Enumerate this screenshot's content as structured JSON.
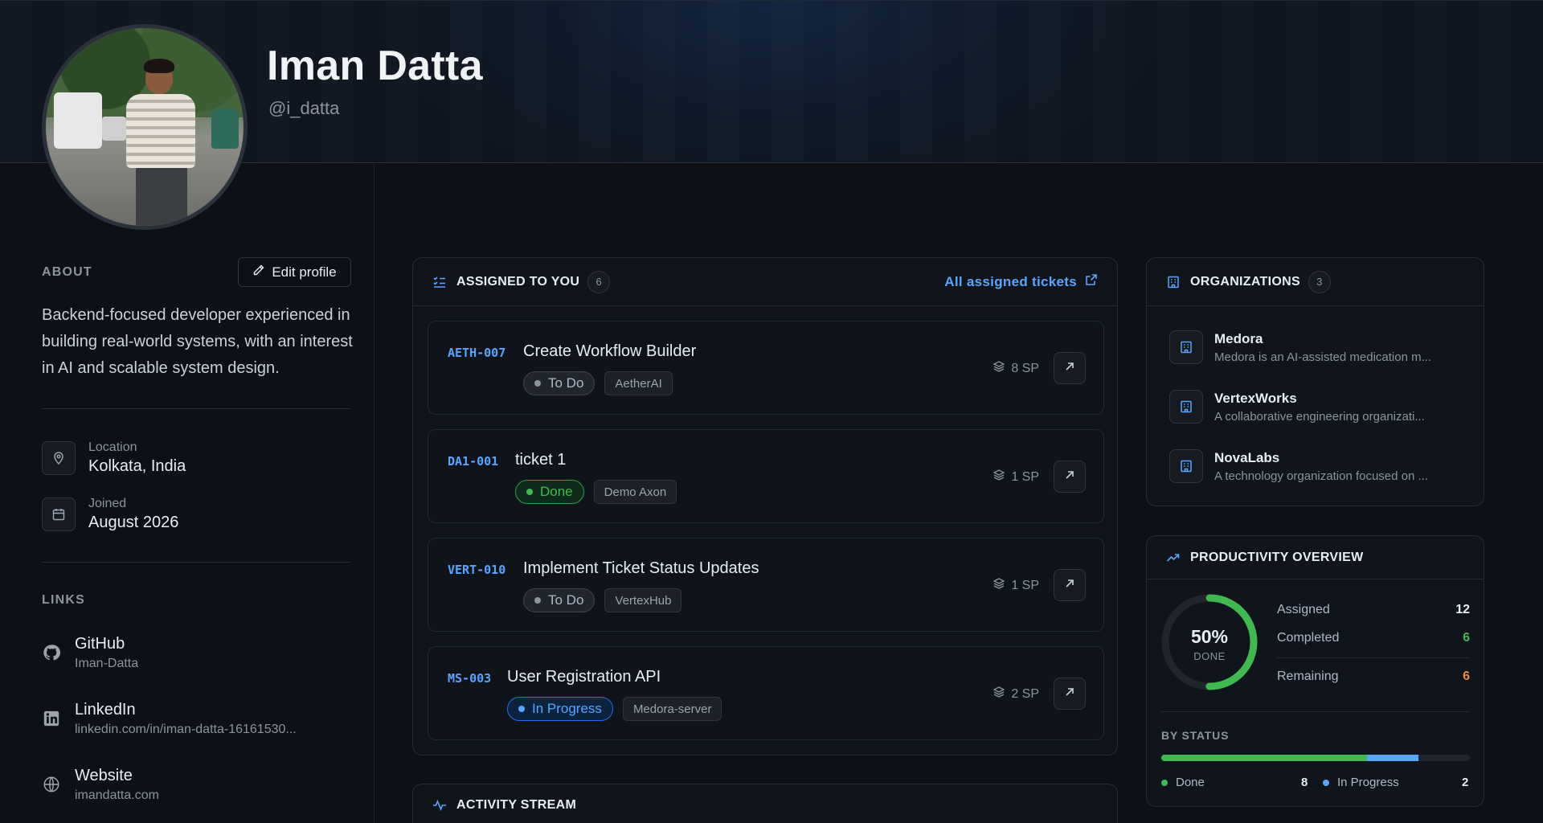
{
  "profile": {
    "name": "Iman Datta",
    "handle": "@i_datta"
  },
  "about": {
    "heading": "ABOUT",
    "edit_label": "Edit profile",
    "bio": "Backend-focused developer experienced in building real-world systems, with an interest in AI and scalable system design.",
    "location_label": "Location",
    "location_value": "Kolkata, India",
    "joined_label": "Joined",
    "joined_value": "August 2026"
  },
  "links": {
    "heading": "LINKS",
    "items": [
      {
        "title": "GitHub",
        "sub": "Iman-Datta",
        "icon": "github-icon"
      },
      {
        "title": "LinkedIn",
        "sub": "linkedin.com/in/iman-datta-16161530...",
        "icon": "linkedin-icon"
      },
      {
        "title": "Website",
        "sub": "imandatta.com",
        "icon": "globe-icon"
      }
    ]
  },
  "assigned": {
    "heading": "ASSIGNED TO YOU",
    "count": "6",
    "all_link": "All assigned tickets",
    "tickets": [
      {
        "key": "AETH-007",
        "title": "Create Workflow Builder",
        "status": "To Do",
        "project": "AetherAI",
        "sp": "8 SP"
      },
      {
        "key": "DA1-001",
        "title": "ticket 1",
        "status": "Done",
        "project": "Demo Axon",
        "sp": "1 SP"
      },
      {
        "key": "VERT-010",
        "title": "Implement Ticket Status Updates",
        "status": "To Do",
        "project": "VertexHub",
        "sp": "1 SP"
      },
      {
        "key": "MS-003",
        "title": "User Registration API",
        "status": "In Progress",
        "project": "Medora-server",
        "sp": "2 SP"
      }
    ]
  },
  "activity": {
    "heading": "ACTIVITY STREAM"
  },
  "organizations": {
    "heading": "ORGANIZATIONS",
    "count": "3",
    "items": [
      {
        "name": "Medora",
        "desc": "Medora is an AI-assisted medication m..."
      },
      {
        "name": "VertexWorks",
        "desc": "A collaborative engineering organizati..."
      },
      {
        "name": "NovaLabs",
        "desc": "A technology organization focused on ..."
      }
    ]
  },
  "productivity": {
    "heading": "PRODUCTIVITY OVERVIEW",
    "percent": "50%",
    "percent_value": 50,
    "done_label": "DONE",
    "assigned_label": "Assigned",
    "assigned_value": "12",
    "completed_label": "Completed",
    "completed_value": "6",
    "remaining_label": "Remaining",
    "remaining_value": "6",
    "by_status_label": "BY STATUS",
    "status_breakdown": [
      {
        "label": "Done",
        "value": "8",
        "count": 8,
        "color": "#3fb950"
      },
      {
        "label": "In Progress",
        "value": "2",
        "count": 2,
        "color": "#58a6ff"
      }
    ],
    "status_total": 12
  },
  "colors": {
    "accent": "#58a6ff",
    "success": "#3fb950",
    "warning": "#f0883e"
  }
}
